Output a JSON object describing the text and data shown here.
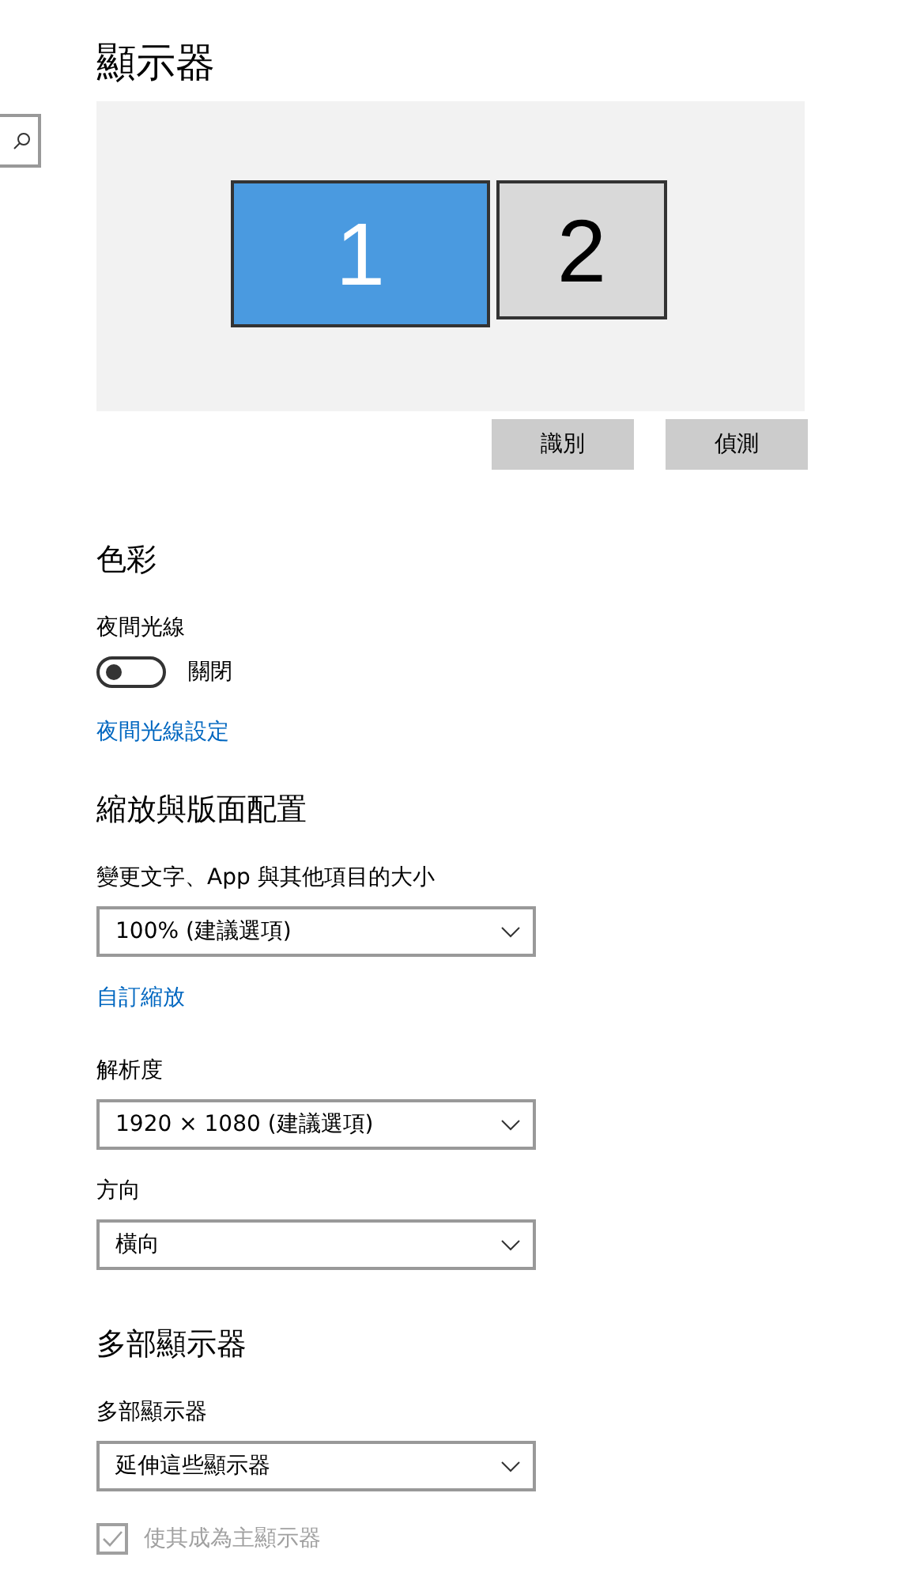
{
  "title": "顯示器",
  "monitors": [
    {
      "label": "1",
      "selected": true
    },
    {
      "label": "2",
      "selected": false
    }
  ],
  "buttons": [
    "識別",
    "偵測"
  ],
  "items": [
    {
      "kind": "heading",
      "text": "色彩"
    },
    {
      "kind": "label",
      "text": "夜間光線"
    },
    {
      "kind": "toggle",
      "text": "關閉",
      "on": false
    },
    {
      "kind": "link",
      "text": "夜間光線設定"
    },
    {
      "kind": "heading",
      "text": "縮放與版面配置"
    },
    {
      "kind": "label",
      "text": "變更文字、App 與其他項目的大小"
    },
    {
      "kind": "dropdown",
      "text": "100% (建議選項)"
    },
    {
      "kind": "link",
      "text": "自訂縮放"
    },
    {
      "kind": "label",
      "text": "解析度"
    },
    {
      "kind": "dropdown",
      "text": "1920 × 1080 (建議選項)"
    },
    {
      "kind": "label",
      "text": "方向"
    },
    {
      "kind": "dropdown",
      "text": "橫向"
    },
    {
      "kind": "heading",
      "text": "多部顯示器"
    },
    {
      "kind": "label",
      "text": "多部顯示器"
    },
    {
      "kind": "dropdown",
      "text": "延伸這些顯示器"
    },
    {
      "kind": "checkbox",
      "text": "使其成為主顯示器",
      "checked": true,
      "disabled": true
    }
  ]
}
